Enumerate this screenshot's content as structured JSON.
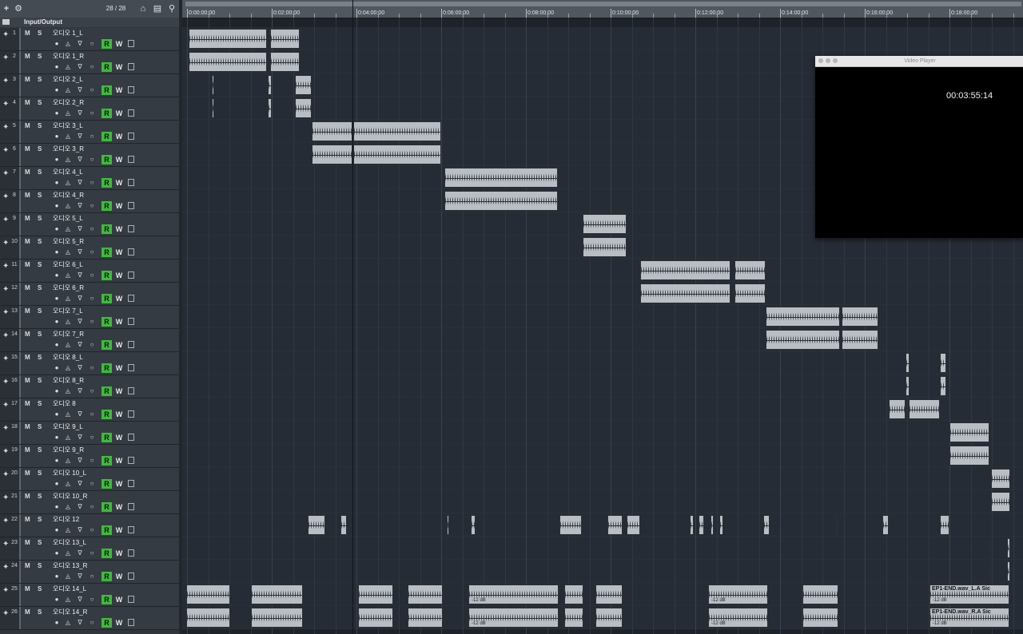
{
  "toolbar": {
    "add_icon": "+",
    "track_count": "28 / 28"
  },
  "folder": {
    "label": "Input/Output"
  },
  "controls": {
    "mute": "M",
    "solo": "S",
    "read": "R",
    "write": "W"
  },
  "tracks": [
    {
      "num": "1",
      "name": "오디오 1_L"
    },
    {
      "num": "2",
      "name": "오디오 1_R"
    },
    {
      "num": "3",
      "name": "오디오 2_L"
    },
    {
      "num": "4",
      "name": "오디오 2_R"
    },
    {
      "num": "5",
      "name": "오디오 3_L"
    },
    {
      "num": "6",
      "name": "오디오 3_R"
    },
    {
      "num": "7",
      "name": "오디오 4_L"
    },
    {
      "num": "8",
      "name": "오디오 4_R"
    },
    {
      "num": "9",
      "name": "오디오 5_L"
    },
    {
      "num": "10",
      "name": "오디오 5_R"
    },
    {
      "num": "11",
      "name": "오디오 6_L"
    },
    {
      "num": "12",
      "name": "오디오 6_R"
    },
    {
      "num": "13",
      "name": "오디오 7_L"
    },
    {
      "num": "14",
      "name": "오디오 7_R"
    },
    {
      "num": "15",
      "name": "오디오 8_L"
    },
    {
      "num": "16",
      "name": "오디오 8_R"
    },
    {
      "num": "17",
      "name": "오디오 8"
    },
    {
      "num": "18",
      "name": "오디오 9_L"
    },
    {
      "num": "19",
      "name": "오디오 9_R"
    },
    {
      "num": "20",
      "name": "오디오 10_L"
    },
    {
      "num": "21",
      "name": "오디오 10_R"
    },
    {
      "num": "22",
      "name": "오디오 12"
    },
    {
      "num": "23",
      "name": "오디오 13_L"
    },
    {
      "num": "24",
      "name": "오디오 13_R"
    },
    {
      "num": "25",
      "name": "오디오 14_L"
    },
    {
      "num": "26",
      "name": "오디오 14_R"
    }
  ],
  "ruler": {
    "labels": [
      "0:00:00:00",
      "0:02:00:00",
      "0:04:00:00",
      "0:06:00:00",
      "0:08:00:00",
      "0:10:00:00",
      "0:12:00:00",
      "0:14:00:00",
      "0:16:00:00",
      "0:18:00:00"
    ]
  },
  "clip_labels": {
    "vol": "-12 dB",
    "ep1_l": "EP1-END.wav_L.A Sic",
    "ep1_r": "EP1-END.wav_R.A Sic"
  },
  "video_player": {
    "title": "Video Player",
    "timecode": "00:03:55:14"
  }
}
